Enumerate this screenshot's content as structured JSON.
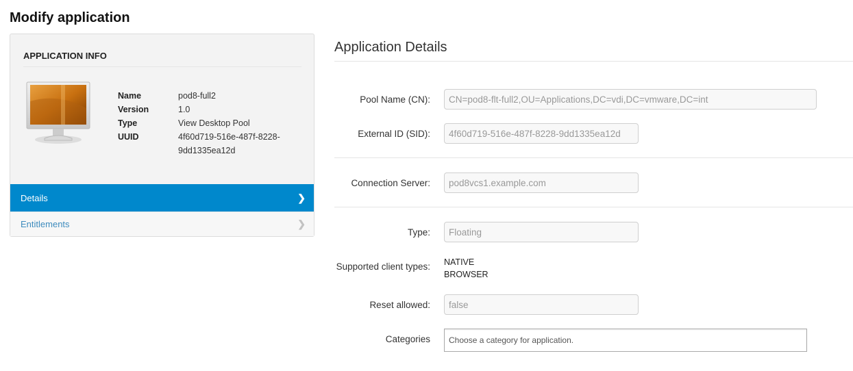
{
  "page": {
    "title": "Modify application"
  },
  "app_info": {
    "header": "APPLICATION INFO",
    "icon": "desktop-monitor-icon",
    "fields": [
      {
        "key": "Name",
        "value": "pod8-full2"
      },
      {
        "key": "Version",
        "value": "1.0"
      },
      {
        "key": "Type",
        "value": "View Desktop Pool"
      },
      {
        "key": "UUID",
        "value": "4f60d719-516e-487f-8228-9dd1335ea12d"
      }
    ]
  },
  "nav": {
    "items": [
      {
        "label": "Details",
        "active": true,
        "icon": "chevron-right-icon"
      },
      {
        "label": "Entitlements",
        "active": false,
        "icon": "chevron-right-icon"
      }
    ]
  },
  "details": {
    "title": "Application Details",
    "pool_name": {
      "label": "Pool Name (CN):",
      "value": "CN=pod8-flt-full2,OU=Applications,DC=vdi,DC=vmware,DC=int"
    },
    "external_id": {
      "label": "External ID (SID):",
      "value": "4f60d719-516e-487f-8228-9dd1335ea12d"
    },
    "connection_server": {
      "label": "Connection Server:",
      "value": "pod8vcs1.example.com"
    },
    "type": {
      "label": "Type:",
      "value": "Floating"
    },
    "client_types": {
      "label": "Supported client types:",
      "values": [
        "NATIVE",
        "BROWSER"
      ]
    },
    "reset_allowed": {
      "label": "Reset allowed:",
      "value": "false"
    },
    "categories": {
      "label": "Categories",
      "placeholder": "Choose a category for application."
    }
  },
  "colors": {
    "accent": "#0088cc",
    "link": "#3d8bbd"
  }
}
